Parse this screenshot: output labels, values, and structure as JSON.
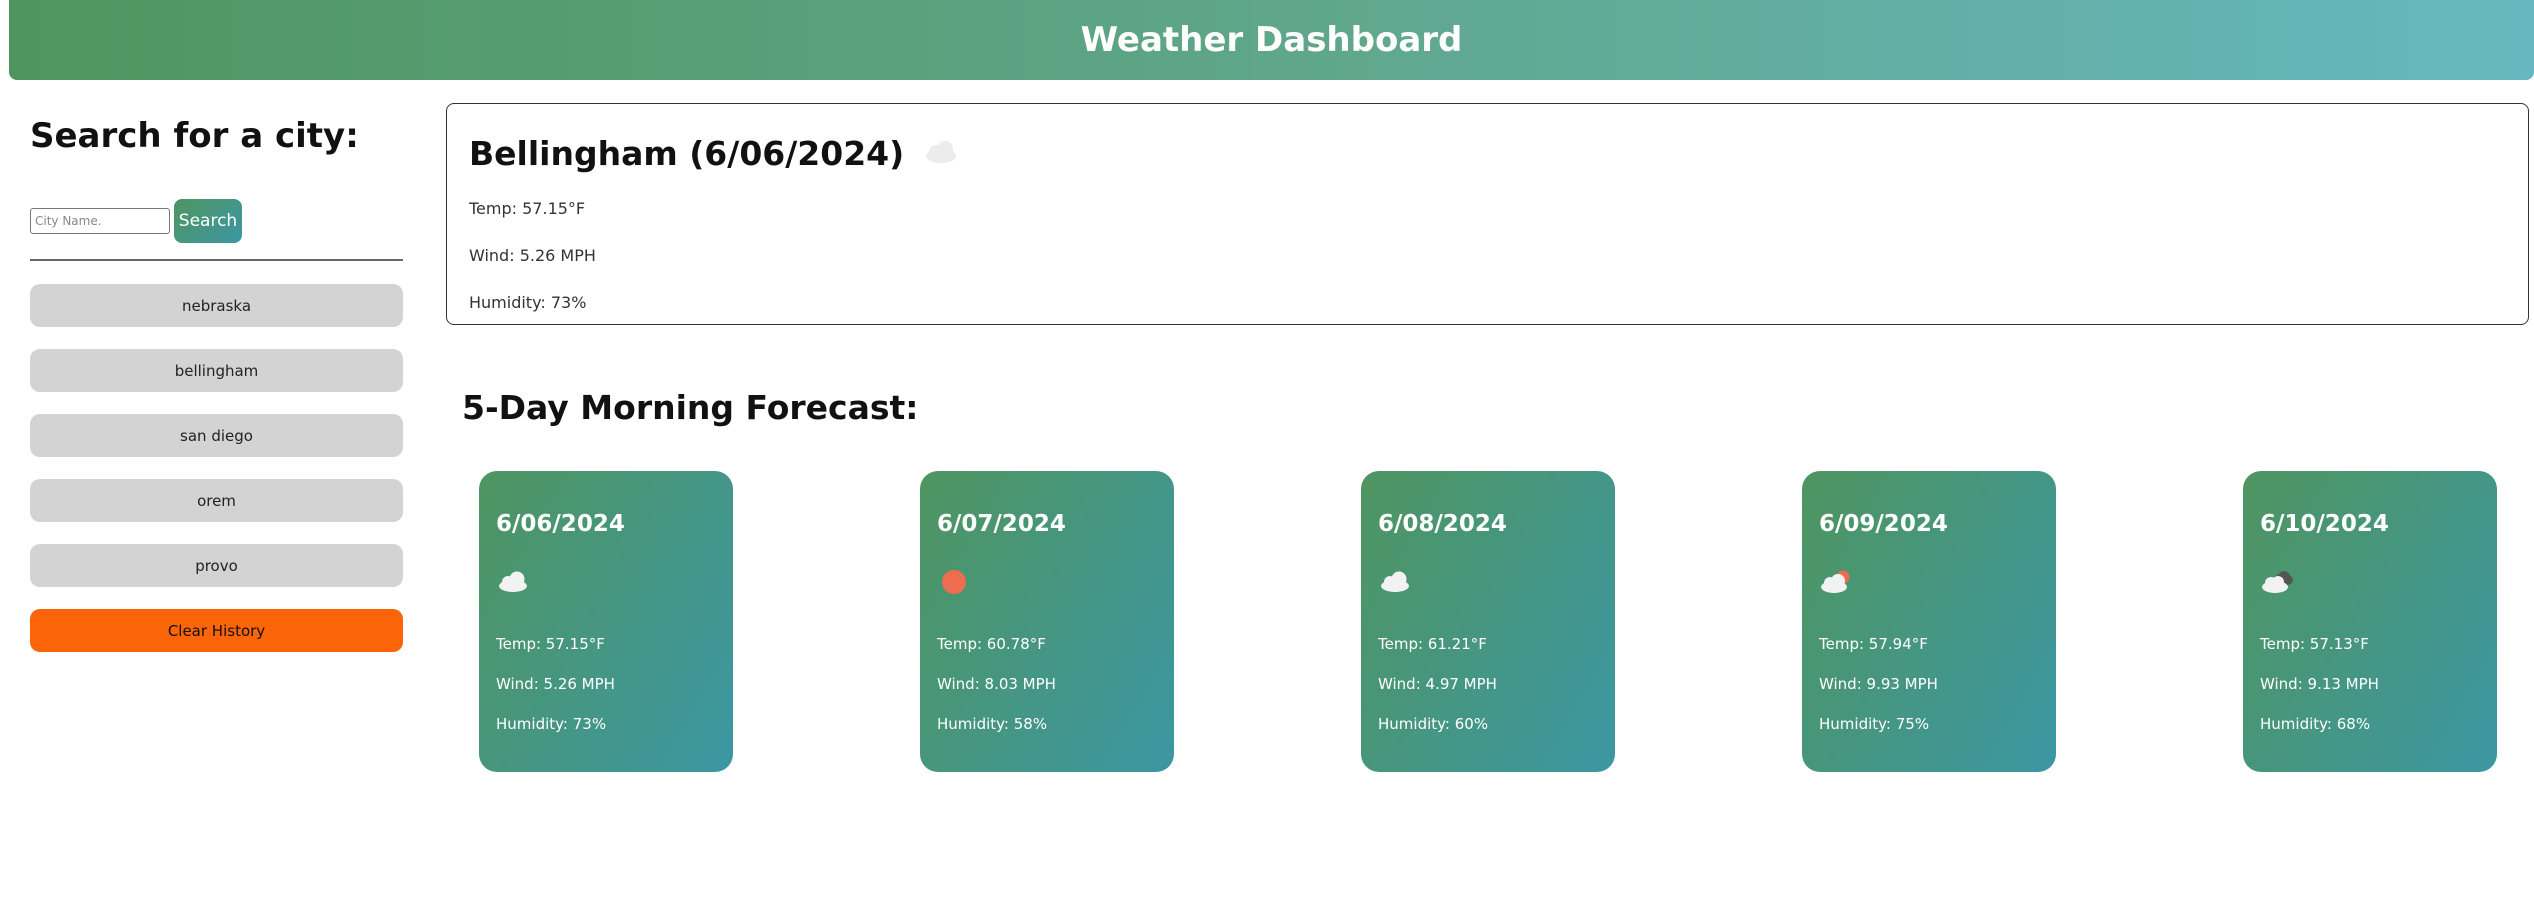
{
  "header": {
    "title": "Weather Dashboard"
  },
  "sidebar": {
    "heading": "Search for a city:",
    "search_placeholder": "City Name.",
    "search_button": "Search",
    "history": [
      "nebraska",
      "bellingham",
      "san diego",
      "orem",
      "provo"
    ],
    "clear_button": "Clear History"
  },
  "current": {
    "title": "Bellingham (6/06/2024)",
    "icon": "cloud-icon",
    "temp": "Temp: 57.15°F",
    "wind": "Wind: 5.26 MPH",
    "humidity": "Humidity: 73%"
  },
  "forecast": {
    "title": "5-Day Morning Forecast:",
    "days": [
      {
        "date": "6/06/2024",
        "icon": "cloud-icon",
        "temp": "Temp: 57.15°F",
        "wind": "Wind: 5.26 MPH",
        "humidity": "Humidity: 73%"
      },
      {
        "date": "6/07/2024",
        "icon": "sun-icon",
        "temp": "Temp: 60.78°F",
        "wind": "Wind: 8.03 MPH",
        "humidity": "Humidity: 58%"
      },
      {
        "date": "6/08/2024",
        "icon": "cloud-icon",
        "temp": "Temp: 61.21°F",
        "wind": "Wind: 4.97 MPH",
        "humidity": "Humidity: 60%"
      },
      {
        "date": "6/09/2024",
        "icon": "partly-cloudy-sun-icon",
        "temp": "Temp: 57.94°F",
        "wind": "Wind: 9.93 MPH",
        "humidity": "Humidity: 75%"
      },
      {
        "date": "6/10/2024",
        "icon": "broken-clouds-icon",
        "temp": "Temp: 57.13°F",
        "wind": "Wind: 9.13 MPH",
        "humidity": "Humidity: 68%"
      }
    ]
  },
  "colors": {
    "header_start": "#4f9560",
    "header_end": "#66b7bf",
    "card_start": "#4f9560",
    "card_end": "#3c97a3",
    "history_button": "#d3d3d3",
    "clear_button": "#fc6409",
    "sun": "#ee6d4f"
  }
}
